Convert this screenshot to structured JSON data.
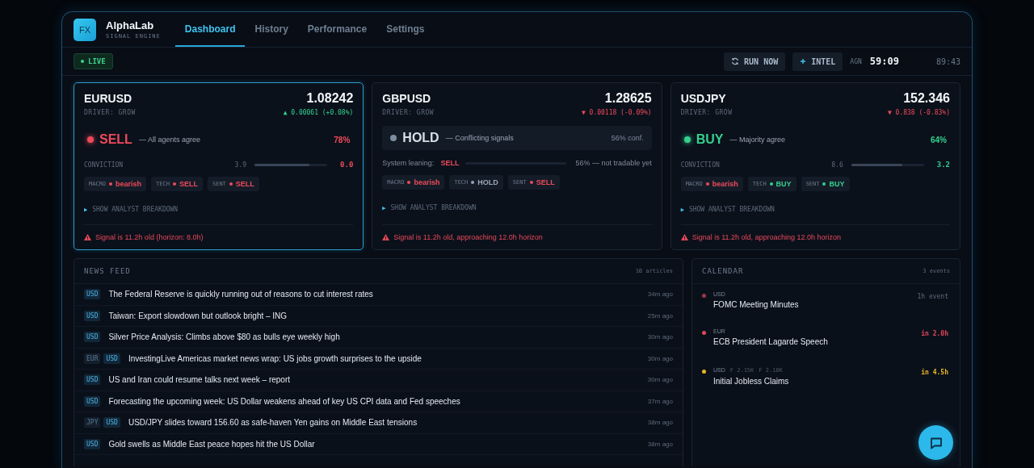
{
  "brand": {
    "logo": "FX",
    "name": "AlphaLab",
    "tagline": "SIGNAL ENGINE"
  },
  "tabs": [
    {
      "label": "Dashboard",
      "selected": true
    },
    {
      "label": "History",
      "selected": false
    },
    {
      "label": "Performance",
      "selected": false
    },
    {
      "label": "Settings",
      "selected": false
    }
  ],
  "status": {
    "label": "LIVE",
    "live": true
  },
  "actions": [
    {
      "label": "RUN NOW"
    },
    {
      "label": "INTEL"
    }
  ],
  "agent": {
    "label": "AGN",
    "countdown": "59:09",
    "clock": "89:43"
  },
  "pairs": [
    {
      "symbol": "EURUSD",
      "selected": true,
      "driver": "DRIVER: GROW",
      "price": "1.08242",
      "change": "▲ 0.00061 (+0.08%)",
      "rising": true,
      "signal": {
        "kind": "sell",
        "label": "SELL",
        "note": "— All agents agree",
        "confidence": "78%"
      },
      "meter": {
        "kind": "conviction",
        "label": "CONVICTION",
        "start": "3.9",
        "level": 0.75,
        "end": "0.0"
      },
      "chips": [
        {
          "label": "MACRO",
          "value": "bearish",
          "color": "#ef4a5a"
        },
        {
          "label": "TECH",
          "value": "SELL",
          "color": "#ef4a5a"
        },
        {
          "label": "SENT",
          "value": "SELL",
          "color": "#ef4a5a"
        }
      ],
      "toggle": "▶",
      "breakdown": "SHOW ANALYST BREAKDOWN",
      "warning": "Signal is 11.2h old (horizon: 8.0h)"
    },
    {
      "symbol": "GBPUSD",
      "selected": false,
      "driver": "DRIVER: GROW",
      "price": "1.28625",
      "change": "▼ 0.00118 (-0.09%)",
      "rising": false,
      "signal": {
        "kind": "hold",
        "label": "HOLD",
        "note": "— Conflicting signals",
        "confidence": "56% conf."
      },
      "meter": {
        "kind": "leaning",
        "label": "System leaning:",
        "value": "SELL",
        "end": "56% — not tradable yet"
      },
      "chips": [
        {
          "label": "MACRO",
          "value": "bearish",
          "color": "#ef4a5a"
        },
        {
          "label": "TECH",
          "value": "HOLD",
          "color": "#9aa6b4"
        },
        {
          "label": "SENT",
          "value": "SELL",
          "color": "#ef4a5a"
        }
      ],
      "toggle": "▶",
      "breakdown": "SHOW ANALYST BREAKDOWN",
      "warning": "Signal is 11.2h old, approaching 12.0h horizon"
    },
    {
      "symbol": "USDJPY",
      "selected": false,
      "driver": "DRIVER: GROW",
      "price": "152.346",
      "change": "▼ 0.838 (-0.83%)",
      "rising": false,
      "signal": {
        "kind": "buy",
        "label": "BUY",
        "note": "— Majority agree",
        "confidence": "64%"
      },
      "meter": {
        "kind": "conviction",
        "label": "CONVICTION",
        "start": "8.6",
        "level": 0.7,
        "end": "3.2"
      },
      "chips": [
        {
          "label": "MACRO",
          "value": "bearish",
          "color": "#ef4a5a"
        },
        {
          "label": "TECH",
          "value": "BUY",
          "color": "#33d08e"
        },
        {
          "label": "SENT",
          "value": "BUY",
          "color": "#33d08e"
        }
      ],
      "toggle": "▶",
      "breakdown": "SHOW ANALYST BREAKDOWN",
      "warning": "Signal is 11.2h old, approaching 12.0h horizon"
    }
  ],
  "news": {
    "title": "NEWS FEED",
    "count": "10 articles",
    "items": [
      {
        "tags": [
          {
            "label": "USD",
            "primary": true
          }
        ],
        "headline": "The Federal Reserve is quickly running out of reasons to cut interest rates",
        "time": "34m ago"
      },
      {
        "tags": [
          {
            "label": "USD",
            "primary": true
          }
        ],
        "headline": "Taiwan: Export slowdown but outlook bright – ING",
        "time": "25m ago"
      },
      {
        "tags": [
          {
            "label": "USD",
            "primary": true
          }
        ],
        "headline": "Silver Price Analysis: Climbs above $80 as bulls eye weekly high",
        "time": "30m ago"
      },
      {
        "tags": [
          {
            "label": "EUR",
            "primary": false
          },
          {
            "label": "USD",
            "primary": true
          }
        ],
        "headline": "InvestingLive Americas market news wrap: US jobs growth surprises to the upside",
        "time": "30m ago"
      },
      {
        "tags": [
          {
            "label": "USD",
            "primary": true
          }
        ],
        "headline": "US and Iran could resume talks next week – report",
        "time": "30m ago"
      },
      {
        "tags": [
          {
            "label": "USD",
            "primary": true
          }
        ],
        "headline": "Forecasting the upcoming week: US Dollar weakens ahead of key US CPI data and Fed speeches",
        "time": "37m ago"
      },
      {
        "tags": [
          {
            "label": "JPY",
            "primary": false
          },
          {
            "label": "USD",
            "primary": true
          }
        ],
        "headline": "USD/JPY slides toward 156.60 as safe-haven Yen gains on Middle East tensions",
        "time": "38m ago"
      },
      {
        "tags": [
          {
            "label": "USD",
            "primary": true
          }
        ],
        "headline": "Gold swells as Middle East peace hopes hit the US Dollar",
        "time": "38m ago"
      }
    ]
  },
  "calendar": {
    "title": "CALENDAR",
    "count": "3 events",
    "events": [
      {
        "currency": "USD",
        "name": "FOMC Meeting Minutes",
        "time": "1h event",
        "soon": false,
        "color": "#9b3a48"
      },
      {
        "currency": "EUR",
        "name": "ECB President Lagarde Speech",
        "time": "in 2.0h",
        "soon": true,
        "color": "#e2475a"
      },
      {
        "currency": "USD",
        "figures": [
          "F 2.15K",
          "F 2.18K"
        ],
        "name": "Initial Jobless Claims",
        "time": "in 4.5h",
        "soon": true,
        "color": "#e8b824"
      }
    ]
  }
}
